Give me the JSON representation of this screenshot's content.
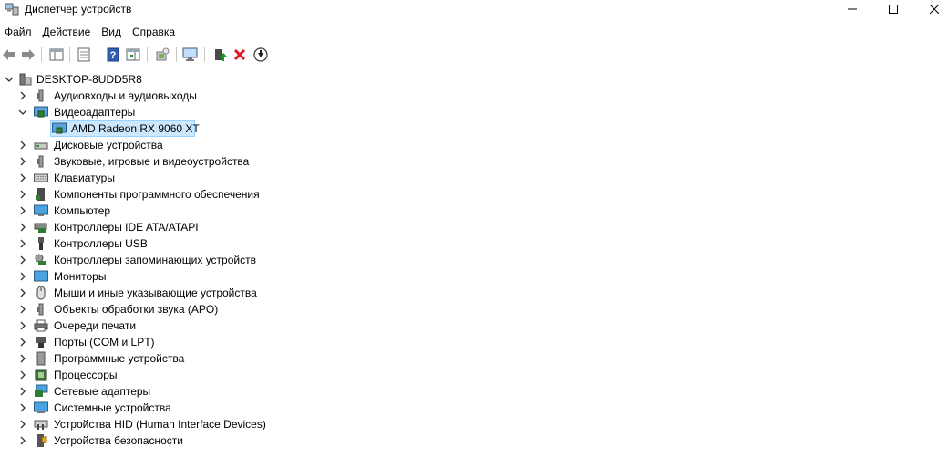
{
  "window": {
    "title": "Диспетчер устройств"
  },
  "menu": {
    "items": [
      "Файл",
      "Действие",
      "Вид",
      "Справка"
    ]
  },
  "toolbar": {
    "buttons": [
      "back-icon",
      "forward-icon",
      "properties-pane-icon",
      "list-view-icon",
      "help-icon",
      "action-pane-icon",
      "update-driver-icon",
      "scan-hardware-icon",
      "enable-device-icon",
      "uninstall-device-icon",
      "disable-device-icon"
    ]
  },
  "tree": {
    "root": "DESKTOP-8UDD5R8",
    "categories": [
      {
        "label": "Аудиовходы и аудиовыходы",
        "icon": "speaker-icon",
        "expanded": false
      },
      {
        "label": "Видеоадаптеры",
        "icon": "display-adapter-icon",
        "expanded": true,
        "children": [
          {
            "label": "AMD Radeon RX 9060 XT",
            "icon": "display-adapter-icon",
            "selected": true
          }
        ]
      },
      {
        "label": "Дисковые устройства",
        "icon": "disk-drive-icon",
        "expanded": false
      },
      {
        "label": "Звуковые, игровые и видеоустройства",
        "icon": "speaker-icon",
        "expanded": false
      },
      {
        "label": "Клавиатуры",
        "icon": "keyboard-icon",
        "expanded": false
      },
      {
        "label": "Компоненты программного обеспечения",
        "icon": "software-component-icon",
        "expanded": false
      },
      {
        "label": "Компьютер",
        "icon": "computer-icon",
        "expanded": false
      },
      {
        "label": "Контроллеры IDE ATA/ATAPI",
        "icon": "ide-controller-icon",
        "expanded": false
      },
      {
        "label": "Контроллеры USB",
        "icon": "usb-icon",
        "expanded": false
      },
      {
        "label": "Контроллеры запоминающих устройств",
        "icon": "storage-controller-icon",
        "expanded": false
      },
      {
        "label": "Мониторы",
        "icon": "monitor-icon",
        "expanded": false
      },
      {
        "label": "Мыши и иные указывающие устройства",
        "icon": "mouse-icon",
        "expanded": false
      },
      {
        "label": "Объекты обработки звука (APO)",
        "icon": "speaker-icon",
        "expanded": false
      },
      {
        "label": "Очереди печати",
        "icon": "printer-icon",
        "expanded": false
      },
      {
        "label": "Порты (COM и LPT)",
        "icon": "port-icon",
        "expanded": false
      },
      {
        "label": "Программные устройства",
        "icon": "software-device-icon",
        "expanded": false
      },
      {
        "label": "Процессоры",
        "icon": "processor-icon",
        "expanded": false
      },
      {
        "label": "Сетевые адаптеры",
        "icon": "network-adapter-icon",
        "expanded": false
      },
      {
        "label": "Системные устройства",
        "icon": "system-device-icon",
        "expanded": false
      },
      {
        "label": "Устройства HID (Human Interface Devices)",
        "icon": "hid-icon",
        "expanded": false
      },
      {
        "label": "Устройства безопасности",
        "icon": "security-device-icon",
        "expanded": false
      }
    ]
  },
  "colors": {
    "selection_bg": "#cce8ff",
    "selection_border": "#99d1ff",
    "uninstall_red": "#e81123",
    "enable_green": "#1a9c2c"
  }
}
